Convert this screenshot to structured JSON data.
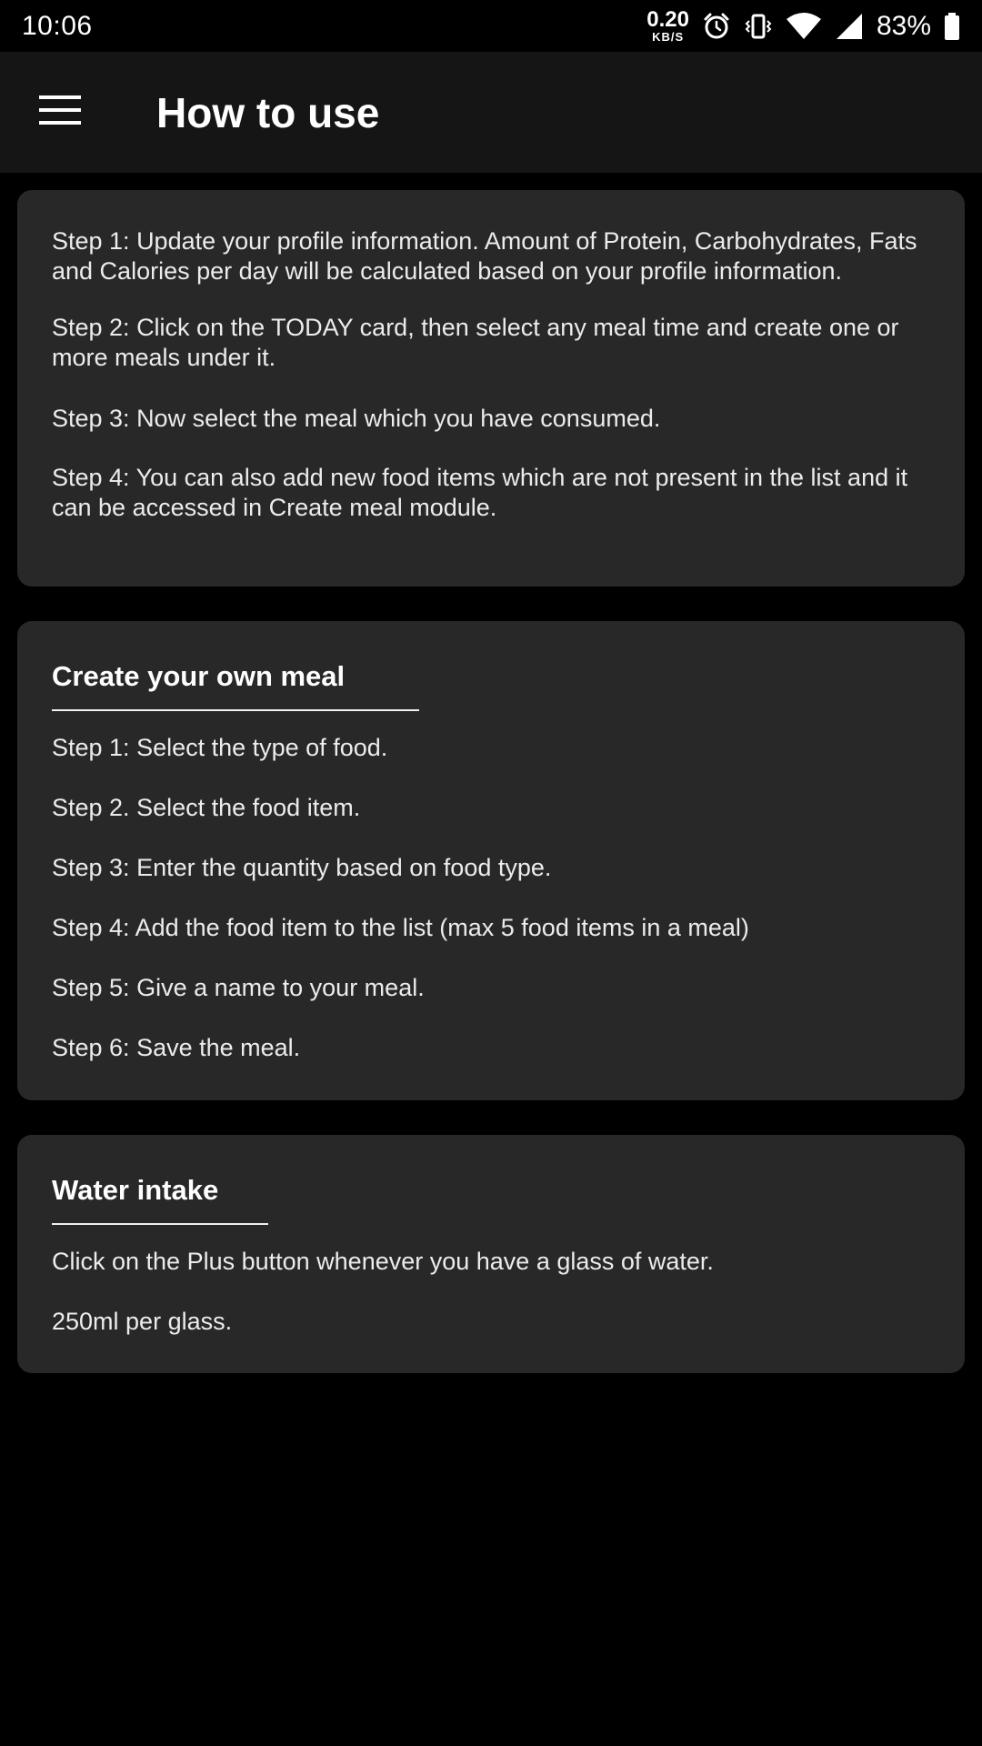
{
  "status_bar": {
    "time": "10:06",
    "net_speed_value": "0.20",
    "net_speed_unit": "KB/S",
    "battery_percent": "83%",
    "icons": [
      "alarm-icon",
      "vibrate-icon",
      "wifi-icon",
      "signal-icon",
      "battery-icon"
    ]
  },
  "app_bar": {
    "title": "How to use",
    "menu_icon": "hamburger-menu-icon"
  },
  "intro_card": {
    "steps": [
      "Step 1: Update your profile information. Amount of Protein, Carbohydrates, Fats and Calories per day will be calculated based on your profile information.",
      "Step 2: Click on the TODAY card, then select any meal time and create one or more meals under it.",
      "Step 3: Now select the meal which you have consumed.",
      "Step 4: You can also add new food items which are not present in the list and it can be accessed in Create meal module."
    ]
  },
  "create_meal_card": {
    "title": "Create your own meal",
    "steps": [
      "Step 1: Select the type of food.",
      "Step 2. Select the food item.",
      "Step 3: Enter the quantity based on food type.",
      "Step 4: Add the food item to the list (max 5 food items in a meal)",
      "Step 5: Give a name to your meal.",
      "Step 6: Save the meal."
    ]
  },
  "water_card": {
    "title": "Water intake",
    "lines": [
      "Click on the Plus button whenever you have a glass of water.",
      "250ml per glass."
    ]
  },
  "colors": {
    "background": "#000000",
    "app_bar": "#151515",
    "card": "#282828",
    "text": "#ececec"
  }
}
